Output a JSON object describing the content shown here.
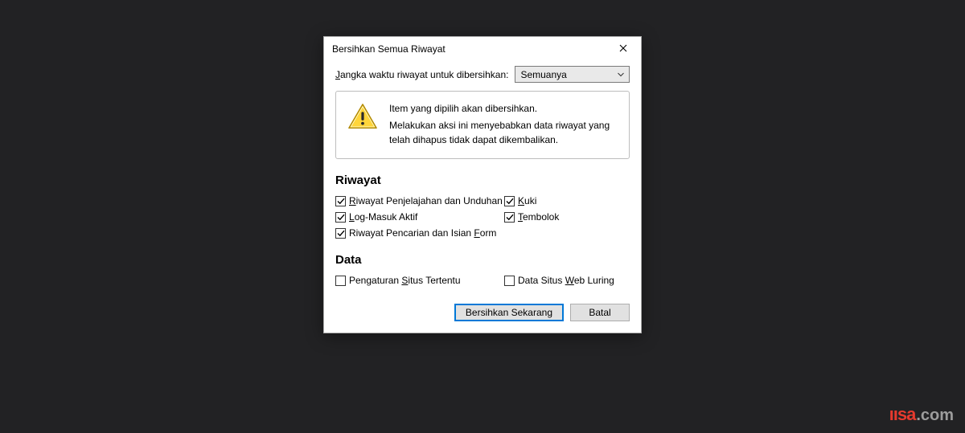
{
  "dialog": {
    "title": "Bersihkan Semua Riwayat",
    "range_label_pre": "J",
    "range_label_post": "angka waktu riwayat untuk dibersihkan:",
    "range_value": "Semuanya",
    "warning": {
      "line1": "Item yang dipilih akan dibersihkan.",
      "line2": "Melakukan aksi ini menyebabkan data riwayat yang telah dihapus tidak dapat dikembalikan."
    },
    "sections": {
      "history_title": "Riwayat",
      "data_title": "Data"
    },
    "checks": {
      "browse": {
        "pre": "R",
        "post": "iwayat Penjelajahan dan Unduhan",
        "checked": true
      },
      "cookies": {
        "pre": "K",
        "post": "uki",
        "checked": true
      },
      "logins": {
        "pre": "L",
        "post": "og-Masuk Aktif",
        "checked": true
      },
      "cache": {
        "pre": "T",
        "post": "embolok",
        "checked": true
      },
      "form": {
        "pre_text": "Riwayat Pencarian dan Isian ",
        "u": "F",
        "post": "orm",
        "checked": true
      },
      "site_settings": {
        "pre_text": "Pengaturan ",
        "u": "S",
        "post": "itus Tertentu",
        "checked": false
      },
      "offline": {
        "pre_text": "Data Situs ",
        "u": "W",
        "post": "eb Luring",
        "checked": false
      }
    },
    "buttons": {
      "clear": "Bersihkan Sekarang",
      "cancel": "Batal"
    }
  },
  "watermark": {
    "brand": "ıısa",
    "suffix": ".com"
  }
}
